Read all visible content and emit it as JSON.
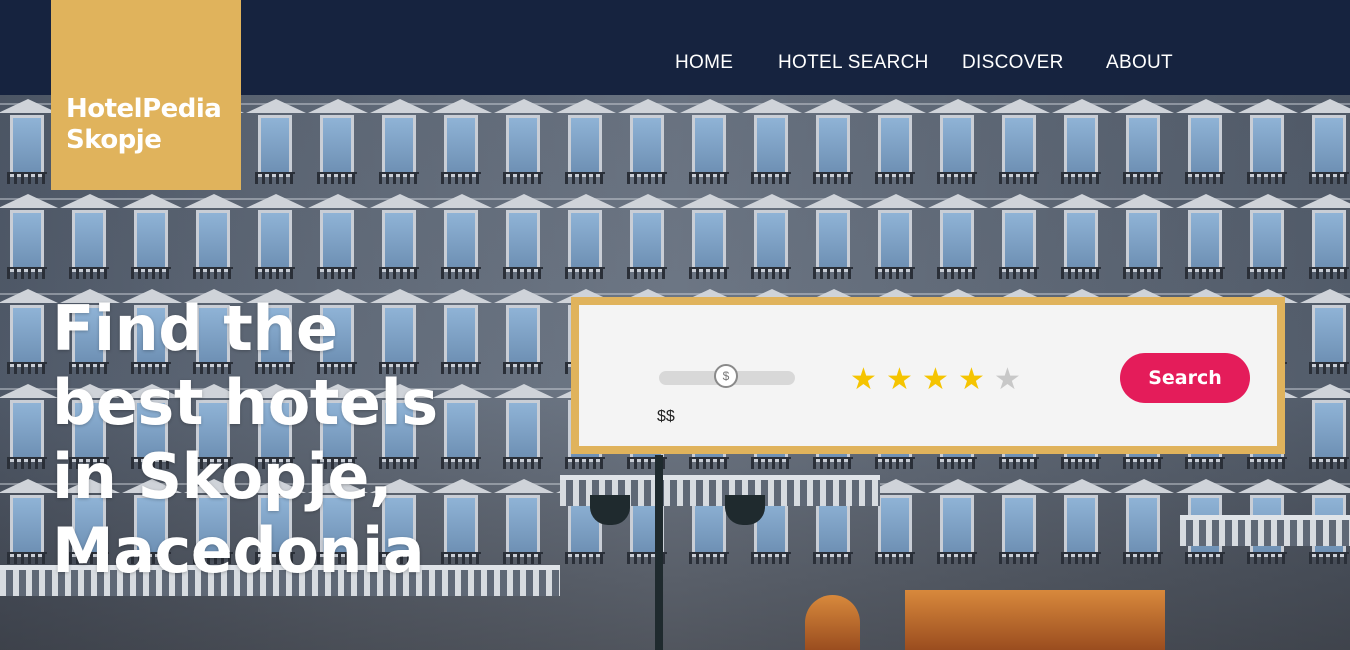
{
  "header": {
    "logo": {
      "line1": "HotelPedia",
      "line2": "Skopje",
      "background": "#e0b35c"
    },
    "background": "#16233f",
    "nav": [
      {
        "label": "HOME"
      },
      {
        "label": "HOTEL SEARCH"
      },
      {
        "label": "DISCOVER"
      },
      {
        "label": "ABOUT"
      }
    ]
  },
  "hero": {
    "title_lines": [
      "Find the",
      "best hotels",
      "in Skopje,",
      "Macedonia"
    ]
  },
  "search": {
    "price_slider": {
      "thumb_icon": "$",
      "value_label": "$$",
      "level": 0.5
    },
    "star_rating": {
      "selected": 4,
      "max": 5,
      "filled_color": "#f5c400",
      "empty_color": "#c8c8c8"
    },
    "search_button_label": "Search",
    "button_color": "#e41c5a",
    "border_color": "#e0b35c"
  }
}
